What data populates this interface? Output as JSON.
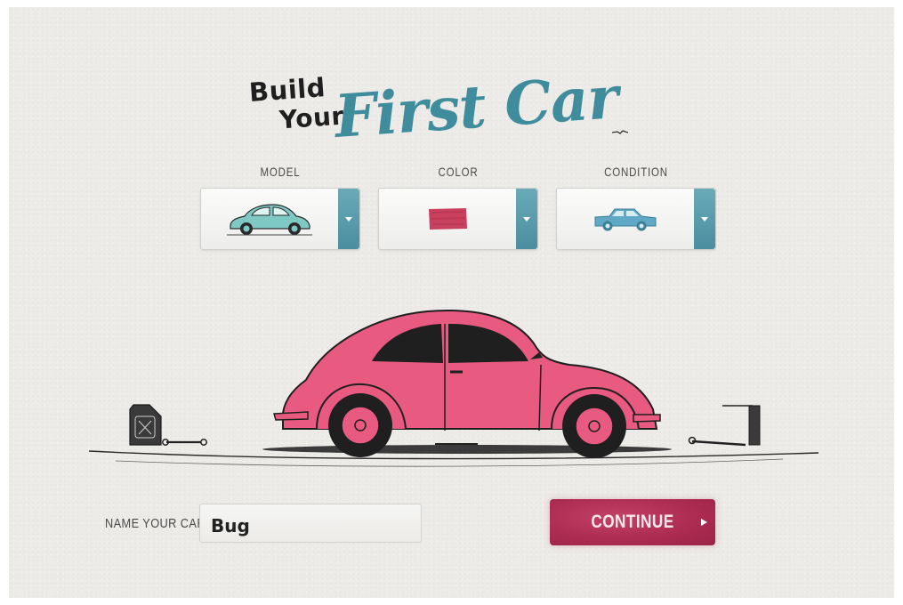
{
  "title": {
    "line1": "Build",
    "line2": "Your",
    "main": "First Car"
  },
  "selectors": [
    {
      "label": "MODEL",
      "selected_icon": "turquoise-beetle-car-icon",
      "color": "#7fc9c5"
    },
    {
      "label": "COLOR",
      "selected_icon": "pink-color-swatch-icon",
      "color": "#c8405d"
    },
    {
      "label": "CONDITION",
      "selected_icon": "blue-sedan-car-icon",
      "color": "#5fa9c6"
    }
  ],
  "illustration": {
    "car_icon": "pink-beetle-car-illustration",
    "car_color": "#e85a7f",
    "props": [
      "oil-can-icon",
      "wrench-icon",
      "spanner-icon",
      "screwdriver-icon",
      "jack-stand-icon"
    ]
  },
  "form": {
    "name_label": "NAME YOUR CAR",
    "name_value": "Bug",
    "continue_label": "CONTINUE"
  },
  "colors": {
    "accent_teal": "#3e8c9c",
    "button_red": "#ad2c52",
    "background": "#ecebe7"
  }
}
